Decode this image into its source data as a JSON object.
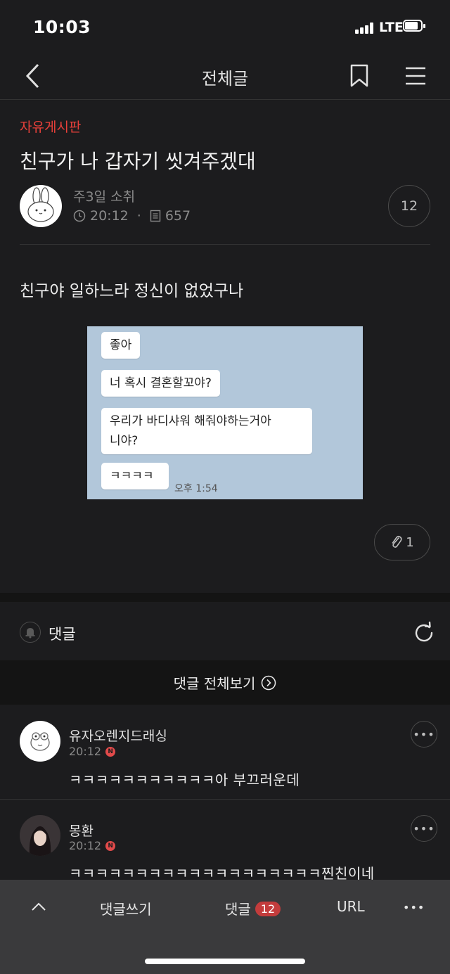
{
  "status_bar": {
    "time": "10:03",
    "network": "LTE"
  },
  "nav": {
    "title": "전체글",
    "icons": [
      "back-chevron-icon",
      "bookmark-icon",
      "menu-icon"
    ]
  },
  "post": {
    "category": "자유게시판",
    "title": "친구가 나 갑자기 씻겨주겠대",
    "author": "주3일 소취",
    "time": "20:12",
    "separator": "·",
    "views": "657",
    "comment_count": "12",
    "body": "친구야 일하느라 정신이 없었구나",
    "attachment_count": "1"
  },
  "chat": {
    "messages": [
      {
        "text": "좋아"
      },
      {
        "text": "너 혹시 결혼할꼬야?"
      },
      {
        "text": "우리가 바디샤워 해줘야하는거아\n니야?"
      },
      {
        "text": "ㅋㅋㅋㅋ"
      }
    ],
    "timestamp": "오후 1:54"
  },
  "comments_section": {
    "label": "댓글",
    "view_all": "댓글 전체보기",
    "comments": [
      {
        "author": "유자오렌지드래싱",
        "time": "20:12",
        "badge": "N",
        "text": "ㅋㅋㅋㅋㅋㅋㅋㅋㅋㅋㅋ아 부끄러운데",
        "more": "•••"
      },
      {
        "author": "몽환",
        "time": "20:12",
        "badge": "N",
        "text": "ㅋㅋㅋㅋㅋㅋㅋㅋㅋㅋㅋㅋㅋㅋㅋㅋㅋㅋㅋ찐친이네",
        "more": "•••"
      }
    ]
  },
  "bottom_bar": {
    "write_comment": "댓글쓰기",
    "comments_label": "댓글",
    "comments_count": "12",
    "url_label": "URL",
    "more": "•••"
  },
  "colors": {
    "accent_red": "#e8403a",
    "background": "#1c1c1e",
    "chat_bg": "#b2c7da"
  }
}
